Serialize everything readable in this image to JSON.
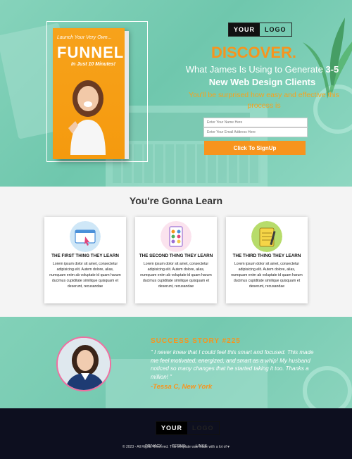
{
  "hero": {
    "logo_left": "YOUR",
    "logo_right": "LOGO",
    "book": {
      "line1": "Launch Your Very Own...",
      "title": "FUNNEL",
      "line3": "In Just 10 Minutes!"
    },
    "headline": "DISCOVER.",
    "subheadline_part1": "What James Is Using to Generate",
    "subheadline_bold": "3-5 New Web Design Clients",
    "tagline": "You'll be surprised how easy and effective this process is",
    "form": {
      "name_placeholder": "Enter Your Name Here",
      "email_placeholder": "Enter Your Email Address Here",
      "button": "Click To SignUp"
    }
  },
  "learn": {
    "title": "You're Gonna Learn",
    "cards": [
      {
        "icon": "browser-cursor-icon",
        "title": "THE FIRST THING THEY LEARN",
        "body": "Lorem ipsum dolor sit amet, consectetur adipisicing elit. Autem dolore, alias, numquam enim ab voluptate id quam harum ducimus cupiditate similique quisquam et deserunt, recusandae"
      },
      {
        "icon": "app-grid-icon",
        "title": "THE SECOND THING THEY LEARN",
        "body": "Lorem ipsum dolor sit amet, consectetur adipisicing elit. Autem dolore, alias, numquam enim ab voluptate id quam harum ducimus cupiditate similique quisquam et deserunt, recusandae"
      },
      {
        "icon": "notepad-pencil-icon",
        "title": "THE THIRD THING THEY LEARN",
        "body": "Lorem ipsum dolor sit amet, consectetur adipisicing elit. Autem dolore, alias, numquam enim ab voluptate id quam harum ducimus cupiditate similique quisquam et deserunt, recusandae"
      }
    ]
  },
  "story": {
    "title": "SUCCESS STORY #225",
    "quote": "\" I never knew that I could feel this smart and focused. This made me feel motivated, energized, and smart as a whip! My husband noticed so many changes that he started taking it too. Thanks a million! \"",
    "author": "-Tessa C, New York"
  },
  "footer": {
    "logo_left": "YOUR",
    "logo_right": "LOGO",
    "links": [
      "PRIVACY",
      "TERMS",
      "LINKS"
    ],
    "copyright": "© 2023 - All Rights Reserved. This template was made with a lot of ♥"
  },
  "colors": {
    "accent": "#f7941d",
    "hero_teal": "#7fcdb5",
    "footer_bg": "#0d0f1f"
  }
}
